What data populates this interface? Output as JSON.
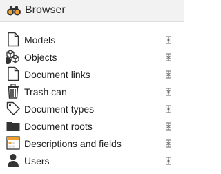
{
  "header": {
    "title": "Browser",
    "icon": "binoculars-icon"
  },
  "colors": {
    "header_bg": "#f2f2f2",
    "binocular_lens": "#f0a030",
    "icon_stroke": "#333333",
    "description_icon_accent": "#f0a030"
  },
  "items": [
    {
      "label": "Models",
      "icon": "document-outline-icon"
    },
    {
      "label": "Objects",
      "icon": "cubes-icon"
    },
    {
      "label": "Document links",
      "icon": "document-outline-icon"
    },
    {
      "label": "Trash can",
      "icon": "trash-icon"
    },
    {
      "label": "Document types",
      "icon": "tag-icon"
    },
    {
      "label": "Document roots",
      "icon": "folder-icon"
    },
    {
      "label": "Descriptions and fields",
      "icon": "calendar-form-icon"
    },
    {
      "label": "Users",
      "icon": "user-icon"
    }
  ]
}
